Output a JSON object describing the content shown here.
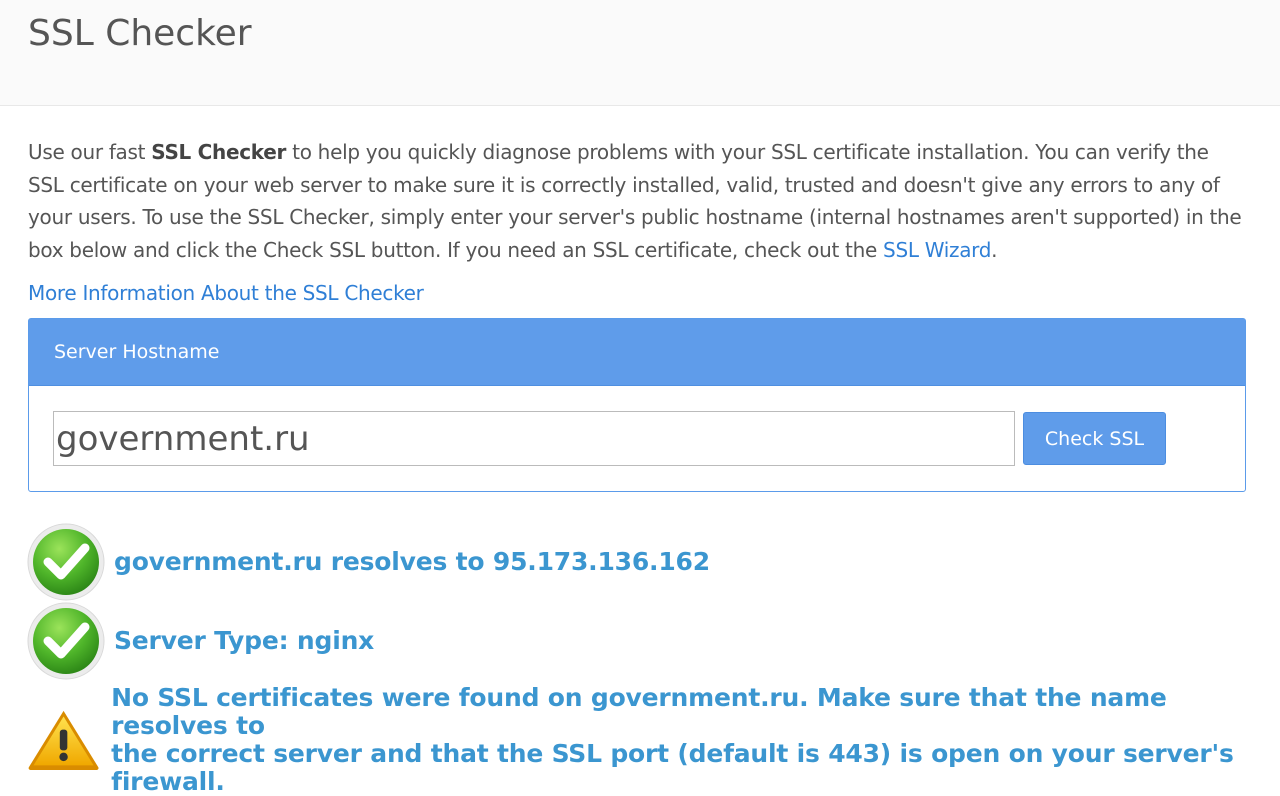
{
  "header": {
    "title": "SSL Checker"
  },
  "intro": {
    "prefix": "Use our fast ",
    "bold": "SSL Checker",
    "body": " to help you quickly diagnose problems with your SSL certificate installation. You can verify the SSL certificate on your web server to make sure it is correctly installed, valid, trusted and doesn't give any errors to any of your users. To use the SSL Checker, simply enter your server's public hostname (internal hostnames aren't supported) in the box below and click the Check SSL button. If you need an SSL certificate, check out the ",
    "wizard_link": "SSL Wizard",
    "suffix": "."
  },
  "more_info_link": "More Information About the SSL Checker",
  "form": {
    "heading": "Server Hostname",
    "hostname_value": "government.ru",
    "button_label": "Check SSL"
  },
  "results": [
    {
      "status": "ok",
      "icon": "green-check-icon",
      "text": "government.ru resolves to 95.173.136.162"
    },
    {
      "status": "ok",
      "icon": "green-check-icon",
      "text": "Server Type: nginx"
    },
    {
      "status": "warning",
      "icon": "warning-triangle-icon",
      "line1": "No SSL certificates were found on government.ru. Make sure that the name resolves to",
      "line2": "the correct server and that the SSL port (default is 443) is open on your server's firewall."
    }
  ],
  "colors": {
    "accent": "#5f9cea",
    "link": "#2f7fd6",
    "result_text": "#3b96d0",
    "success": "#5fbf2c",
    "warning": "#f5b400"
  }
}
